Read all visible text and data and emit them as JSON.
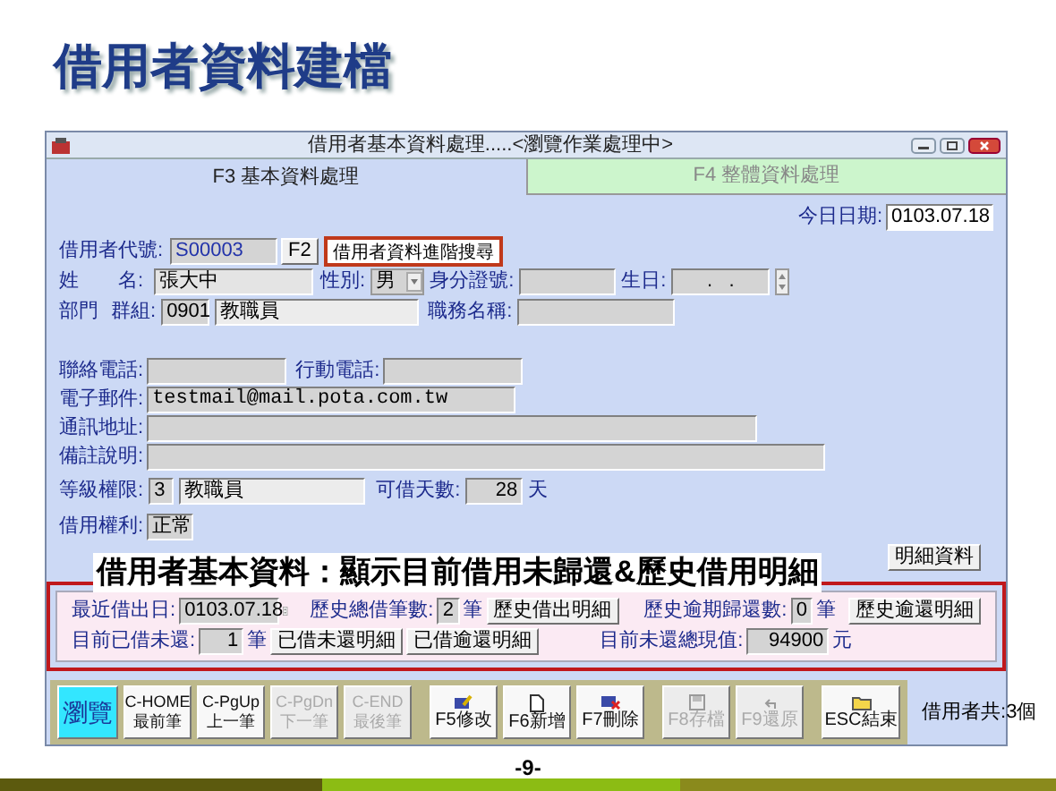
{
  "slide_title": "借用者資料建檔",
  "window": {
    "title": "借用者基本資料處理.....<瀏覽作業處理中>"
  },
  "tabs": [
    {
      "label": "F3 基本資料處理",
      "selected": true
    },
    {
      "label": "F4 整體資料處理",
      "selected": false
    }
  ],
  "today": {
    "label": "今日日期:",
    "value": "0103.07.18"
  },
  "borrower_code": {
    "label": "借用者代號:",
    "value": "S00003",
    "lookup_key": "F2",
    "advanced_search_button": "借用者資料進階搜尋"
  },
  "name": {
    "label": "姓　　名:",
    "value": "張大中"
  },
  "gender": {
    "label": "性別:",
    "value": "男"
  },
  "id_number": {
    "label": "身分證號:"
  },
  "birthday": {
    "label": "生日:",
    "value": ".   ."
  },
  "department": {
    "label": "部門"
  },
  "group": {
    "label": "群組:",
    "code": "0901",
    "value": "教職員"
  },
  "job_title": {
    "label": "職務名稱:"
  },
  "phone": {
    "label": "聯絡電話:"
  },
  "mobile": {
    "label": "行動電話:"
  },
  "email": {
    "label": "電子郵件:",
    "value": "testmail@mail.pota.com.tw"
  },
  "address": {
    "label": "通訊地址:"
  },
  "remarks": {
    "label": "備註說明:"
  },
  "access_grade": {
    "label": "等級權限:",
    "code": "3",
    "value": "教職員"
  },
  "loan_days": {
    "label": "可借天數:",
    "value": "28",
    "unit": "天"
  },
  "borrow_right": {
    "label": "借用權利:",
    "value": "正常"
  },
  "caption": "借用者基本資料：顯示目前借用未歸還&歷史借用明細",
  "detail_button": "明細資料",
  "loan_summary": {
    "last_loan_date": {
      "label": "最近借出日:",
      "value": "0103.07.18"
    },
    "total_loans": {
      "label": "歷史總借筆數:",
      "value": "2",
      "unit": "筆",
      "button": "歷史借出明細"
    },
    "overdue_returns": {
      "label": "歷史逾期歸還數:",
      "value": "0",
      "unit": "筆",
      "button": "歷史逾還明細"
    },
    "current_unreturned": {
      "label": "目前已借未還:",
      "value": "1",
      "unit": "筆",
      "buttons": [
        "已借未還明細",
        "已借逾還明細"
      ]
    },
    "unreturned_value": {
      "label": "目前未還總現值:",
      "value": "94900",
      "unit": "元"
    }
  },
  "toolbar": [
    [
      {
        "kind": "mode",
        "lines": [
          "瀏覽"
        ],
        "selected": true
      },
      {
        "kind": "nav",
        "lines": [
          "C-HOME",
          "最前筆"
        ],
        "disabled": false
      },
      {
        "kind": "nav",
        "lines": [
          "C-PgUp",
          "上一筆"
        ],
        "disabled": false
      },
      {
        "kind": "nav",
        "lines": [
          "C-PgDn",
          "下一筆"
        ],
        "disabled": true
      },
      {
        "kind": "nav",
        "lines": [
          "C-END",
          "最後筆"
        ],
        "disabled": true
      }
    ],
    [
      {
        "kind": "edit",
        "lines": [
          "F5修改"
        ],
        "disabled": false
      },
      {
        "kind": "new",
        "lines": [
          "F6新增"
        ],
        "disabled": false
      },
      {
        "kind": "delete",
        "lines": [
          "F7刪除"
        ],
        "disabled": false
      }
    ],
    [
      {
        "kind": "save",
        "lines": [
          "F8存檔"
        ],
        "disabled": true
      },
      {
        "kind": "undo",
        "lines": [
          "F9還原"
        ],
        "disabled": true
      }
    ],
    [
      {
        "kind": "exit",
        "lines": [
          "ESC結束"
        ],
        "disabled": false
      }
    ]
  ],
  "user_count": {
    "label": "借用者共:",
    "value": "3個"
  },
  "page_number": "-9-"
}
